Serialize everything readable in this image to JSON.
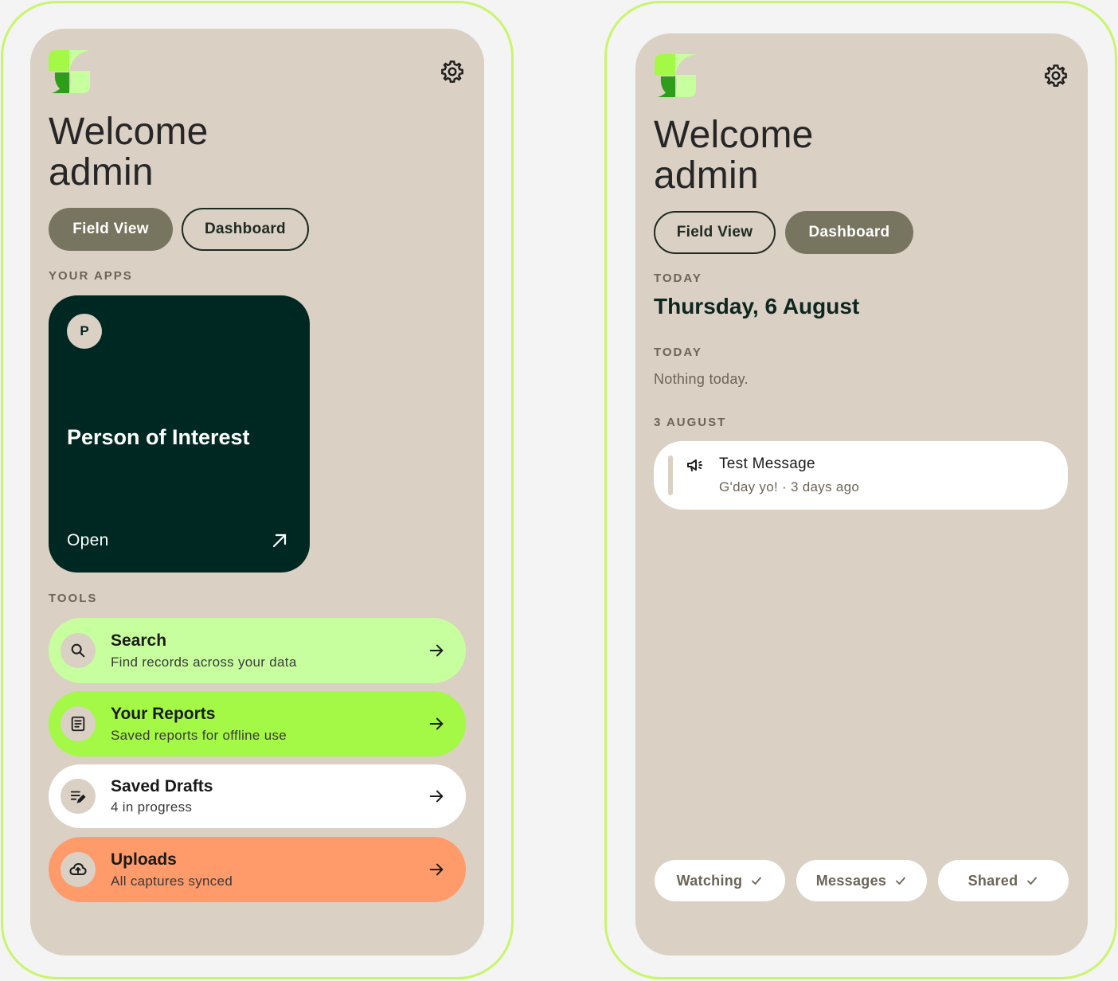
{
  "colors": {
    "accent_lime": "#c8f56e",
    "card_bg": "#dad0c4",
    "dark_green": "#002822",
    "pill_filled": "#77745f",
    "tool_search": "#c8ff9e",
    "tool_reports": "#a3f946",
    "tool_drafts": "#ffffff",
    "tool_uploads": "#ff9a6a"
  },
  "left": {
    "welcome_line1": "Welcome",
    "welcome_line2": "admin",
    "tabs": [
      {
        "label": "Field View",
        "active": true
      },
      {
        "label": "Dashboard",
        "active": false
      }
    ],
    "apps_label": "YOUR APPS",
    "app": {
      "avatar": "P",
      "title": "Person of Interest",
      "open_label": "Open"
    },
    "tools_label": "TOOLS",
    "tools": [
      {
        "title": "Search",
        "subtitle": "Find records across your data",
        "icon": "search-icon"
      },
      {
        "title": "Your Reports",
        "subtitle": "Saved reports for offline use",
        "icon": "report-icon"
      },
      {
        "title": "Saved Drafts",
        "subtitle": "4 in progress",
        "icon": "edit-list-icon"
      },
      {
        "title": "Uploads",
        "subtitle": "All captures synced",
        "icon": "cloud-upload-icon"
      }
    ]
  },
  "right": {
    "welcome_line1": "Welcome",
    "welcome_line2": "admin",
    "tabs": [
      {
        "label": "Field View",
        "active": false
      },
      {
        "label": "Dashboard",
        "active": true
      }
    ],
    "today_label": "TODAY",
    "date": "Thursday, 6 August",
    "today_label_2": "TODAY",
    "nothing_text": "Nothing today.",
    "group_label": "3 AUGUST",
    "message": {
      "title": "Test Message",
      "subtitle": "G'day yo! · 3 days ago",
      "icon": "megaphone-icon"
    },
    "filters": [
      {
        "label": "Watching"
      },
      {
        "label": "Messages"
      },
      {
        "label": "Shared"
      }
    ]
  }
}
